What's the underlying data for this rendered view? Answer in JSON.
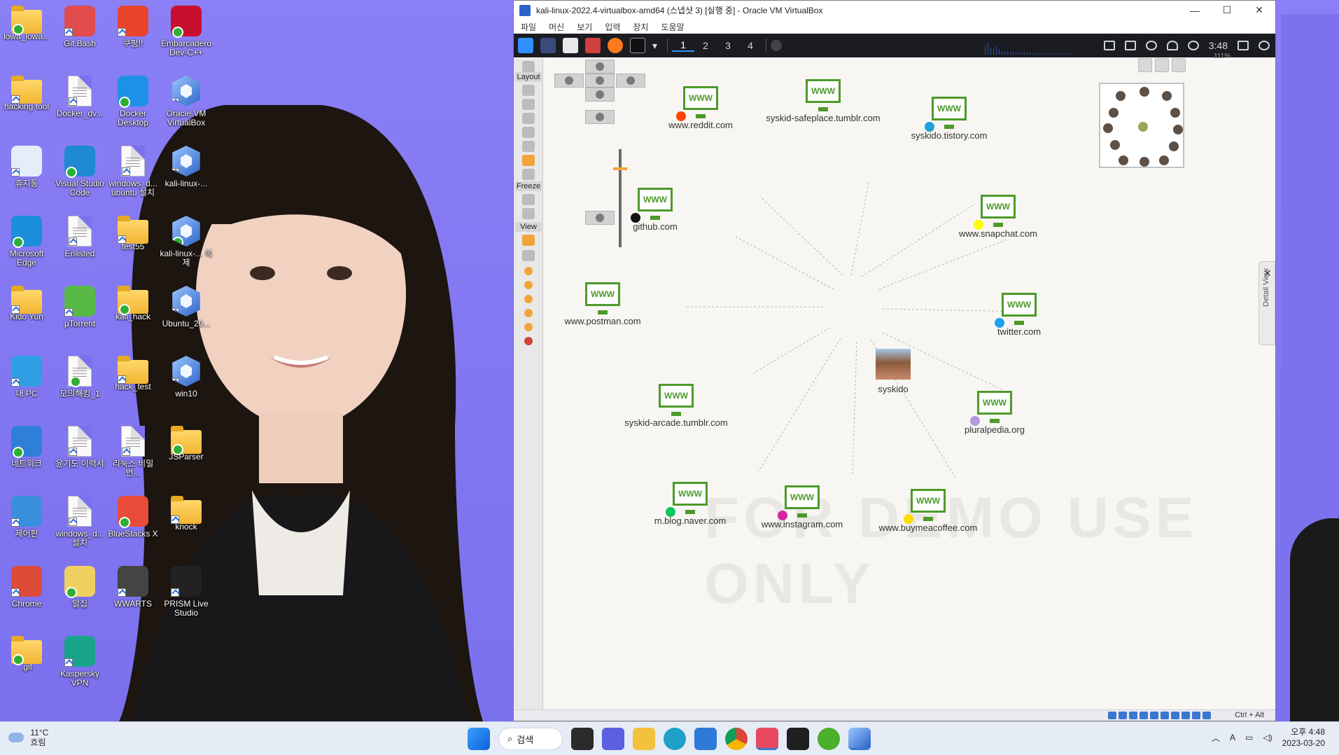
{
  "desktop": {
    "icons": [
      {
        "label": "lowa_lowa..."
      },
      {
        "label": "Git Bash"
      },
      {
        "label": "쿠팡!!"
      },
      {
        "label": "Embarcadero Dev-C++"
      },
      {
        "label": "hacking tool"
      },
      {
        "label": "Docker_dv..."
      },
      {
        "label": "Docker Desktop"
      },
      {
        "label": "Oracle VM VirtualBox"
      },
      {
        "label": "휴지통"
      },
      {
        "label": "Visual Studio Code"
      },
      {
        "label": "windows_d... ubuntu 설치"
      },
      {
        "label": "kali-linux-..."
      },
      {
        "label": "Microsoft Edge"
      },
      {
        "label": "Enlisted"
      },
      {
        "label": "test55"
      },
      {
        "label": "kali-linux-... 복제"
      },
      {
        "label": "Kido Yun"
      },
      {
        "label": "μTorrent"
      },
      {
        "label": "kali_hack"
      },
      {
        "label": "Ubuntu_20..."
      },
      {
        "label": "내 PC"
      },
      {
        "label": "모의해킹_1"
      },
      {
        "label": "hack_test"
      },
      {
        "label": "win10"
      },
      {
        "label": "네트워크"
      },
      {
        "label": "윤기도 이력서"
      },
      {
        "label": "리눅스 비밀번..."
      },
      {
        "label": "JSParser"
      },
      {
        "label": "제어판"
      },
      {
        "label": "windows_d... 설치"
      },
      {
        "label": "BlueStacks X"
      },
      {
        "label": "knock"
      },
      {
        "label": "Chrome"
      },
      {
        "label": "알집"
      },
      {
        "label": "WWARTS"
      },
      {
        "label": "PRISM Live Studio"
      },
      {
        "label": ".git"
      },
      {
        "label": "Kaspersky VPN"
      }
    ]
  },
  "vbox": {
    "title": "kali-linux-2022.4-virtualbox-amd64 (스냅샷 3) [실행 중] - Oracle VM VirtualBox",
    "window_buttons": [
      "—",
      "☐",
      "✕"
    ],
    "menu": [
      "파일",
      "머신",
      "보기",
      "입력",
      "장치",
      "도움말"
    ],
    "kali": {
      "workspaces": [
        "1",
        "2",
        "3",
        "4"
      ],
      "clock": "3:48"
    },
    "status": {
      "hostkey": "Ctrl + Alt"
    }
  },
  "maltego": {
    "tool_labels": {
      "layout": "Layout",
      "freeze": "Freeze",
      "view": "View"
    },
    "zoom": "111%",
    "watermark": "FOR DEMO USE ONLY",
    "detail_view": "Detail View",
    "hub": {
      "label": "syskido"
    },
    "nodes": [
      {
        "label": "www.reddit.com",
        "badge": "#ff4500"
      },
      {
        "label": "syskid-safeplace.tumblr.com",
        "badge": ""
      },
      {
        "label": "syskido.tistory.com",
        "badge": "#1ea1d8"
      },
      {
        "label": "github.com",
        "badge": "#111111"
      },
      {
        "label": "www.snapchat.com",
        "badge": "#fffc00"
      },
      {
        "label": "www.postman.com",
        "badge": ""
      },
      {
        "label": "twitter.com",
        "badge": "#1da1f2"
      },
      {
        "label": "syskid-arcade.tumblr.com",
        "badge": ""
      },
      {
        "label": "pluralpedia.org",
        "badge": "#b09ad8"
      },
      {
        "label": "m.blog.naver.com",
        "badge": "#03c75a"
      },
      {
        "label": "www.instagram.com",
        "badge": "#d6249f"
      },
      {
        "label": "www.buymeacoffee.com",
        "badge": "#ffdd00"
      }
    ],
    "www_text": "WWW"
  },
  "taskbar": {
    "weather_temp": "11°C",
    "weather_desc": "흐림",
    "search_label": "검색",
    "time": "오후 4:48",
    "date": "2023-03-20",
    "ime": "A"
  },
  "colors": {
    "accent": "#4d9a2a",
    "wallpaper": "#7b70ee",
    "kali_bar": "#1b1c22"
  }
}
